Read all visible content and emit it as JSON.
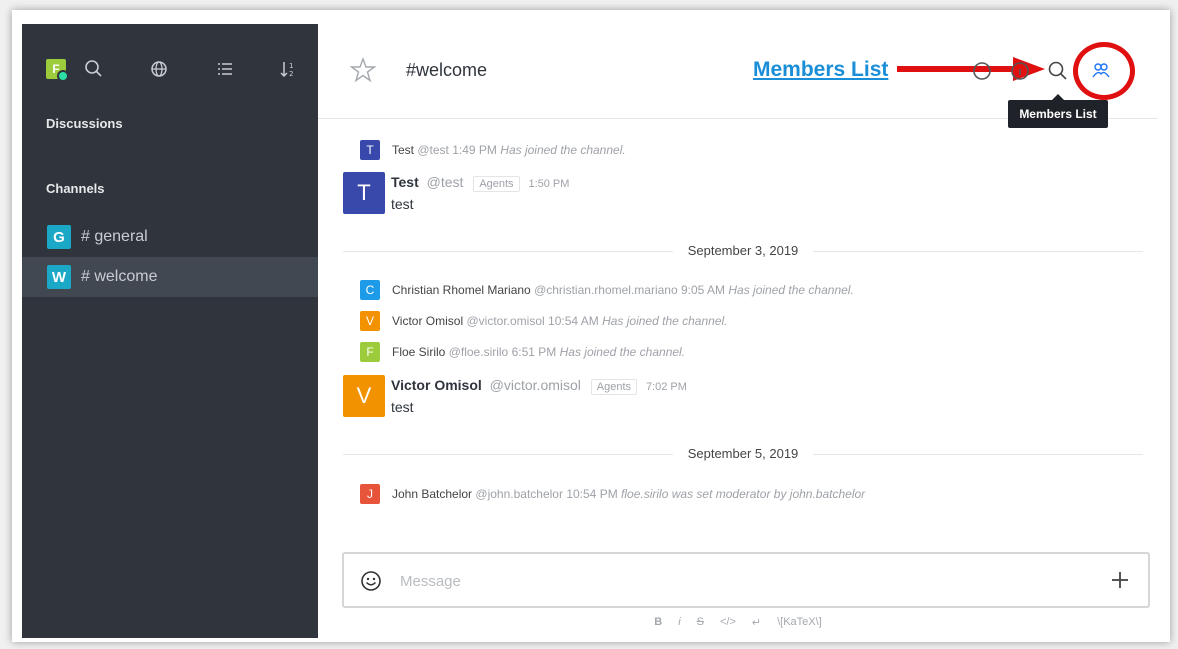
{
  "sidebar": {
    "user_initial": "F",
    "sections": {
      "discussions": "Discussions",
      "channels": "Channels"
    },
    "channels": [
      {
        "initial": "G",
        "name": "# general"
      },
      {
        "initial": "W",
        "name": "# welcome"
      }
    ]
  },
  "header": {
    "room_title": "#welcome",
    "annotation_label": "Members List",
    "tooltip": "Members List"
  },
  "messages": {
    "sys1": {
      "initial": "T",
      "user": "Test",
      "handle": "@test",
      "time": "1:49 PM",
      "text": "Has joined the channel."
    },
    "msg1": {
      "initial": "T",
      "user": "Test",
      "handle": "@test",
      "role": "Agents",
      "time": "1:50 PM",
      "text": "test"
    },
    "day1": "September 3, 2019",
    "sys2": {
      "initial": "C",
      "user": "Christian Rhomel Mariano",
      "handle": "@christian.rhomel.mariano",
      "time": "9:05 AM",
      "text": "Has joined the channel."
    },
    "sys3": {
      "initial": "V",
      "user": "Victor Omisol",
      "handle": "@victor.omisol",
      "time": "10:54 AM",
      "text": "Has joined the channel."
    },
    "sys4": {
      "initial": "F",
      "user": "Floe Sirilo",
      "handle": "@floe.sirilo",
      "time": "6:51 PM",
      "text": "Has joined the channel."
    },
    "msg2": {
      "initial": "V",
      "user": "Victor Omisol",
      "handle": "@victor.omisol",
      "role": "Agents",
      "time": "7:02 PM",
      "text": "test"
    },
    "day2": "September 5, 2019",
    "sys5": {
      "initial": "J",
      "user": "John Batchelor",
      "handle": "@john.batchelor",
      "time": "10:54 PM",
      "text": "floe.sirilo was set moderator by john.batchelor"
    }
  },
  "composer": {
    "placeholder": "Message",
    "toolbar": {
      "bold": "B",
      "italic": "i",
      "strike": "S",
      "code": "</>",
      "multiline": "↵",
      "katex": "\\[KaTeX\\]"
    }
  },
  "colors": {
    "sidebar_bg": "#2f343d",
    "accent": "#1a8fd8",
    "annotation_red": "#e01010",
    "avatar_test": "#3949ab",
    "avatar_christian": "#1d9be9",
    "avatar_victor": "#f39200",
    "avatar_floe": "#9ccc3c",
    "avatar_john": "#e8543a",
    "channel_avatar": "#1aa8c6"
  },
  "icons": [
    "search-icon",
    "globe-icon",
    "list-icon",
    "sort-icon",
    "star-icon",
    "call-icon",
    "info-icon",
    "search-icon",
    "members-icon",
    "emoji-icon",
    "plus-icon"
  ]
}
